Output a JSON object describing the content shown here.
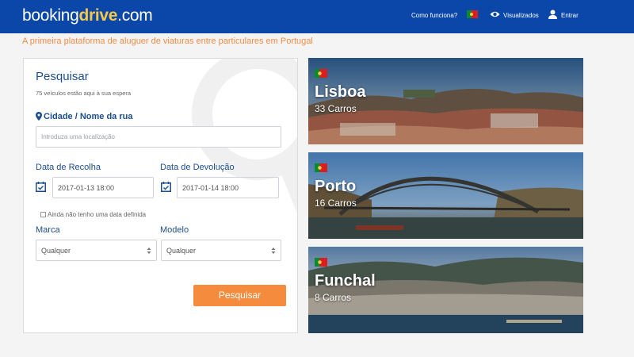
{
  "header": {
    "logo_booking": "booking",
    "logo_drive": "drive",
    "logo_com": ".com",
    "how_it_works": "Como funciona?",
    "viewed": "Visualizados",
    "enter": "Entrar"
  },
  "tagline": "A primeira plataforma de aluguer de viaturas entre particulares em Portugal",
  "search": {
    "title": "Pesquisar",
    "subtitle": "75 veículos estão aqui à sua espera",
    "location_label": "Cidade / Nome da rua",
    "location_placeholder": "Introduza uma localização",
    "pickup_label": "Data de Recolha",
    "pickup_value": "2017-01-13 18:00",
    "return_label": "Data de Devolução",
    "return_value": "2017-01-14 18:00",
    "no_date_label": "Ainda não tenho uma data definida",
    "brand_label": "Marca",
    "brand_value": "Qualquer",
    "model_label": "Modelo",
    "model_value": "Qualquer",
    "submit_label": "Pesquisar"
  },
  "cities": [
    {
      "name": "Lisboa",
      "count": "33 Carros"
    },
    {
      "name": "Porto",
      "count": "16 Carros"
    },
    {
      "name": "Funchal",
      "count": "8 Carros"
    }
  ],
  "colors": {
    "header_bg": "#0a47a9",
    "accent_orange": "#f58b3c",
    "label_blue": "#1b4e8c",
    "logo_yellow": "#f6c94a"
  }
}
